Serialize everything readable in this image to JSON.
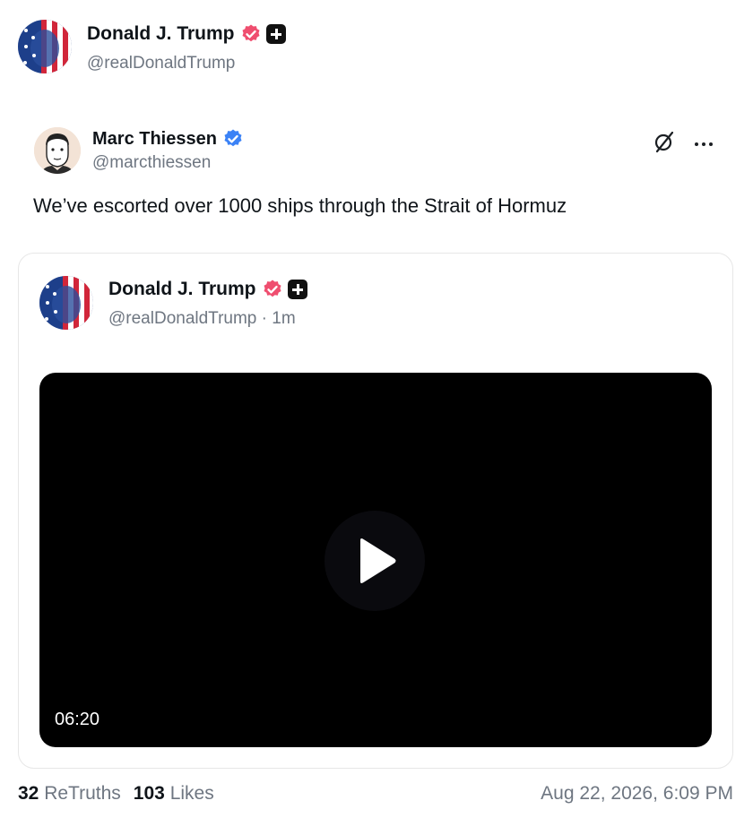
{
  "header_author": {
    "display_name": "Donald J. Trump",
    "handle": "@realDonaldTrump"
  },
  "reposter": {
    "display_name": "Marc Thiessen",
    "handle": "@marcthiessen"
  },
  "post": {
    "text": "We’ve escorted over 1000 ships through the Strait of Hormuz"
  },
  "quoted_post": {
    "display_name": "Donald J. Trump",
    "handle": "@realDonaldTrump",
    "time_ago": "· 1m",
    "video_duration": "06:20"
  },
  "stats": {
    "retruths_count": "32",
    "retruths_label": "ReTruths",
    "likes_count": "103",
    "likes_label": "Likes",
    "timestamp": "Aug 22, 2026, 6:09 PM"
  },
  "colors": {
    "verified_pink": "#ef4e6f",
    "verified_blue": "#3b82f6",
    "text_primary": "#0f1419",
    "text_secondary": "#6e7681"
  },
  "icons": [
    "verified-pink-badge",
    "plus-badge",
    "verified-blue-badge",
    "rebroadcast-icon",
    "more-icon",
    "play-icon"
  ]
}
